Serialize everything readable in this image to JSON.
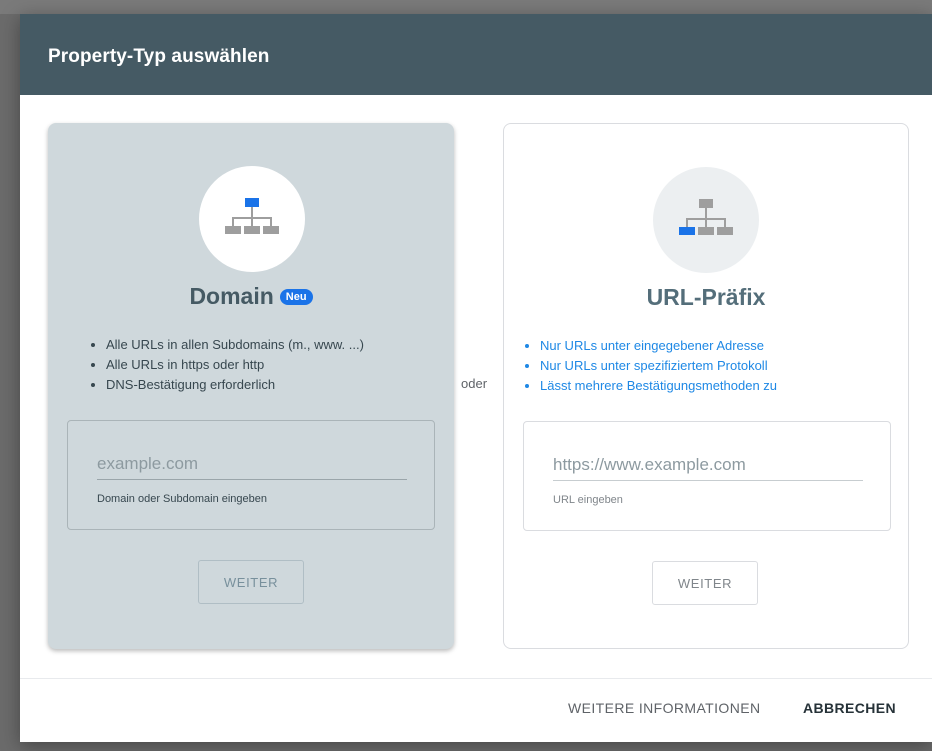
{
  "dialog": {
    "title": "Property-Typ auswählen"
  },
  "domain_card": {
    "icon": "sitemap-icon",
    "title": "Domain",
    "badge": "Neu",
    "features": [
      "Alle URLs in allen Subdomains (m., www. ...)",
      "Alle URLs in https oder http",
      "DNS-Bestätigung erforderlich"
    ],
    "input": {
      "value": "",
      "placeholder": "example.com",
      "hint": "Domain oder Subdomain eingeben"
    },
    "button_label": "WEITER"
  },
  "separator": "oder",
  "url_card": {
    "icon": "sitemap-icon",
    "title": "URL-Präfix",
    "features": [
      "Nur URLs unter eingegebener Adresse",
      "Nur URLs unter spezifiziertem Protokoll",
      "Lässt mehrere Bestätigungsmethoden zu"
    ],
    "input": {
      "value": "",
      "placeholder": "https://www.example.com",
      "hint": "URL eingeben"
    },
    "button_label": "WEITER"
  },
  "footer": {
    "more_info_label": "WEITERE INFORMATIONEN",
    "cancel_label": "ABBRECHEN"
  },
  "colors": {
    "header_bg": "#455a64",
    "domain_card_bg": "#cfd8dc",
    "accent_blue": "#1a73e8",
    "url_feature_text": "#1e88e5"
  }
}
